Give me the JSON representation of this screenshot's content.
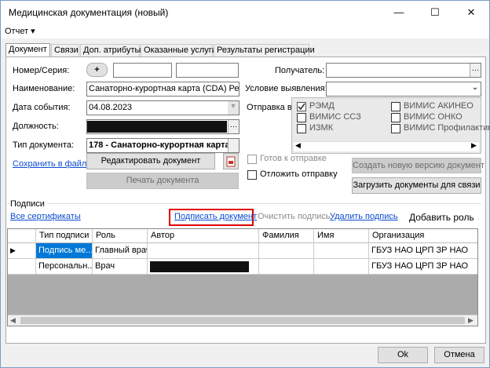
{
  "window": {
    "title": "Медицинская документация (новый)",
    "minimize": "—",
    "maximize": "☐",
    "close": "✕"
  },
  "menu": {
    "report": "Отчет ▾"
  },
  "tabs": [
    "Документ",
    "Связи",
    "Доп. атрибуты",
    "Оказанные услуги",
    "Результаты регистрации"
  ],
  "form": {
    "number_label": "Номер/Серия:",
    "plus": "+",
    "name_label": "Наименование:",
    "name_value": "Санаторно-курортная карта (CDA) Редакци",
    "date_label": "Дата события:",
    "date_value": "04.08.2023",
    "position_label": "Должность:",
    "doctype_label": "Тип документа:",
    "doctype_value": "178 - Санаторно-курортная карта",
    "save_file": "Сохранить в файл",
    "edit_doc": "Редактировать документ",
    "print_doc": "Печать документа",
    "recipient_label": "Получатель:",
    "condition_label": "Условие выявления:",
    "send_label": "Отправка в",
    "send_options": [
      {
        "label": "РЭМД",
        "checked": true
      },
      {
        "label": "ВИМИС АКИНЕО",
        "checked": false
      },
      {
        "label": "ВИМИС ССЗ",
        "checked": false
      },
      {
        "label": "ВИМИС ОНКО",
        "checked": false
      },
      {
        "label": "ИЗМК",
        "checked": false
      },
      {
        "label": "ВИМИС Профилактик...",
        "checked": false
      }
    ],
    "ready_label": "Готов к отправке",
    "defer_label": "Отложить отправку",
    "new_version": "Создать новую версию документ",
    "load_docs": "Загрузить документы для связи"
  },
  "signatures": {
    "title": "Подписи",
    "all_certs": "Все сертификаты",
    "sign_doc": "Подписать документ",
    "clear_sig": "Очистить подпись",
    "delete_sig": "Удалить подпись",
    "add_role": "Добавить роль",
    "columns": [
      "Тип подписи",
      "Роль",
      "Автор",
      "Фамилия",
      "Имя",
      "Организация"
    ],
    "rows": [
      {
        "type": "Подпись ме...",
        "role": "Главный врач",
        "org": "ГБУЗ НАО ЦРП ЗР НАО"
      },
      {
        "type": "Персональн...",
        "role": "Врач",
        "org": "ГБУЗ НАО ЦРП ЗР НАО"
      }
    ]
  },
  "footer": {
    "ok": "Ok",
    "cancel": "Отмена"
  },
  "colors": {
    "accent": "#0078d7",
    "highlight_border": "#e00000",
    "link": "#0b4cd0"
  },
  "icons": {
    "pdf": "pdf-icon",
    "dropdown": "chevron-down-icon",
    "ellipsis": "ellipsis-icon"
  }
}
